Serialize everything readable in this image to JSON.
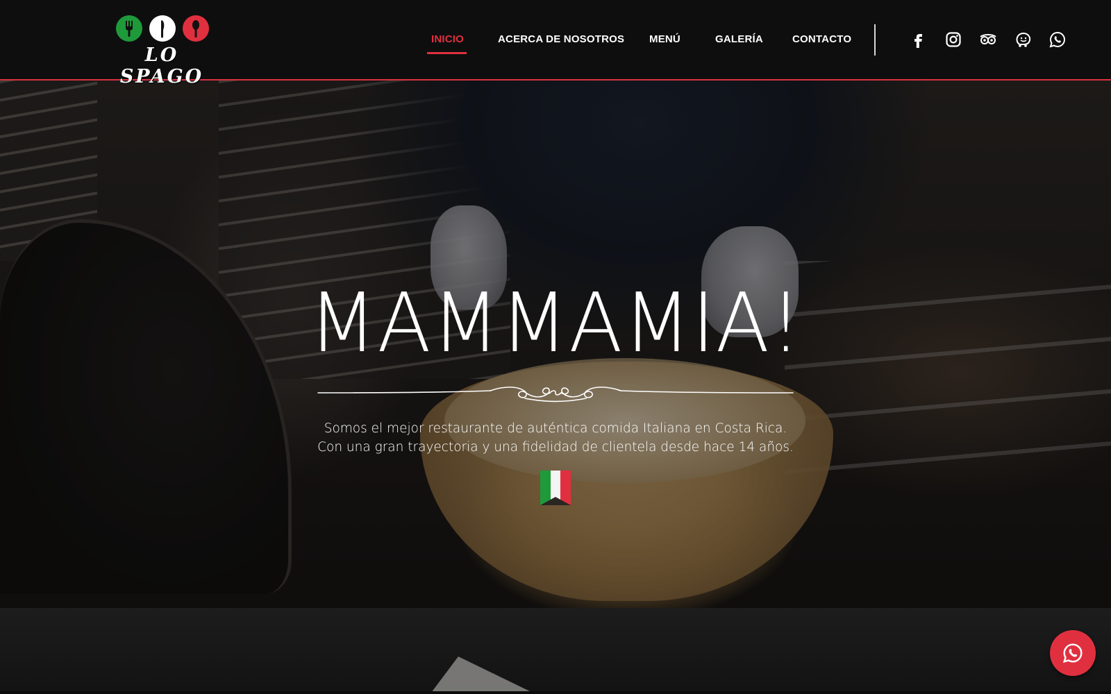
{
  "brand": {
    "logo_text": "LO SPAGO",
    "logo_circle_colors": [
      "#1f9a3a",
      "#ffffff",
      "#e0303f"
    ],
    "logo_icons": [
      "fork-icon",
      "knife-icon",
      "spoon-icon"
    ]
  },
  "nav": {
    "items": [
      {
        "label": "INICIO",
        "active": true
      },
      {
        "label": "ACERCA DE NOSOTROS",
        "active": false
      },
      {
        "label": "MENÚ",
        "active": false
      },
      {
        "label": "GALERÍA",
        "active": false
      },
      {
        "label": "CONTACTO",
        "active": false
      }
    ],
    "social_icons": [
      "facebook-icon",
      "instagram-icon",
      "tripadvisor-icon",
      "waze-icon",
      "whatsapp-icon"
    ]
  },
  "hero": {
    "title": "MAMMAMIA!",
    "subtitle_line1": "Somos el mejor restaurante de auténtica comida Italiana en Costa Rica.",
    "subtitle_line2": "Con una gran trayectoria y una fidelidad de clientela desde hace 14 años.",
    "flag_colors": [
      "#1f9a3a",
      "#ffffff",
      "#e0303f"
    ]
  },
  "fab": {
    "icon": "whatsapp-icon"
  },
  "colors": {
    "accent": "#e0303f",
    "header_bg": "#0e0e0f"
  }
}
